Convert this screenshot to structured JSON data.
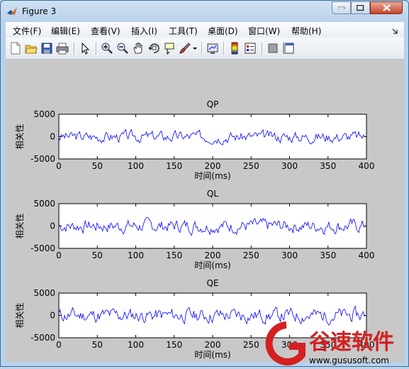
{
  "window": {
    "title": "Figure 3",
    "accent": "#3f6f9c"
  },
  "menu": [
    {
      "label": "文件(F)"
    },
    {
      "label": "编辑(E)"
    },
    {
      "label": "查看(V)"
    },
    {
      "label": "插入(I)"
    },
    {
      "label": "工具(T)"
    },
    {
      "label": "桌面(D)"
    },
    {
      "label": "窗口(W)"
    },
    {
      "label": "帮助(H)"
    }
  ],
  "toolbar": {
    "icons": [
      "new-figure-icon",
      "open-file-icon",
      "save-icon",
      "print-icon",
      "edit-plot-arrow-icon",
      "zoom-in-icon",
      "zoom-out-icon",
      "pan-hand-icon",
      "rotate-3d-icon",
      "data-cursor-icon",
      "brush-icon",
      "brush-dropdown-icon",
      "link-plot-icon",
      "colorbar-icon",
      "legend-icon",
      "hide-plot-tools-icon",
      "show-plot-tools-icon"
    ]
  },
  "chart_data": [
    {
      "type": "line",
      "title": "QP",
      "xlabel": "时间(ms)",
      "ylabel": "相关性",
      "xlim": [
        0,
        400
      ],
      "ylim": [
        -5000,
        5000
      ],
      "xticks": [
        "0",
        "50",
        "100",
        "150",
        "200",
        "250",
        "300",
        "350",
        "400"
      ],
      "yticks": [
        "5000",
        "0",
        "-5000"
      ],
      "series": [
        {
          "color": "#0000ff",
          "amplitude": 1000,
          "seed": 3,
          "description_values": "noise-like signal from x=0 to x=400 around 0, range approx -1500..2000"
        }
      ]
    },
    {
      "type": "line",
      "title": "QL",
      "xlabel": "时间(ms)",
      "ylabel": "相关性",
      "xlim": [
        0,
        400
      ],
      "ylim": [
        -5000,
        5000
      ],
      "xticks": [
        "0",
        "50",
        "100",
        "150",
        "200",
        "250",
        "300",
        "350",
        "400"
      ],
      "yticks": [
        "5000",
        "0",
        "-5000"
      ],
      "series": [
        {
          "color": "#0000ff",
          "amplitude": 1200,
          "seed": 7
        }
      ]
    },
    {
      "type": "line",
      "title": "QE",
      "xlabel": "时间(ms)",
      "ylabel": "相关性",
      "xlim": [
        0,
        400
      ],
      "ylim": [
        -5000,
        5000
      ],
      "xticks": [
        "0",
        "50",
        "100",
        "150",
        "200",
        "250",
        "300",
        "350",
        "400"
      ],
      "yticks": [
        "5000",
        "0",
        "-5000"
      ],
      "series": [
        {
          "color": "#0000ff",
          "amplitude": 1300,
          "seed": 11
        }
      ]
    }
  ],
  "watermark": {
    "text": "谷速软件",
    "url": "www.gususoft.com",
    "color": "#d42020"
  }
}
